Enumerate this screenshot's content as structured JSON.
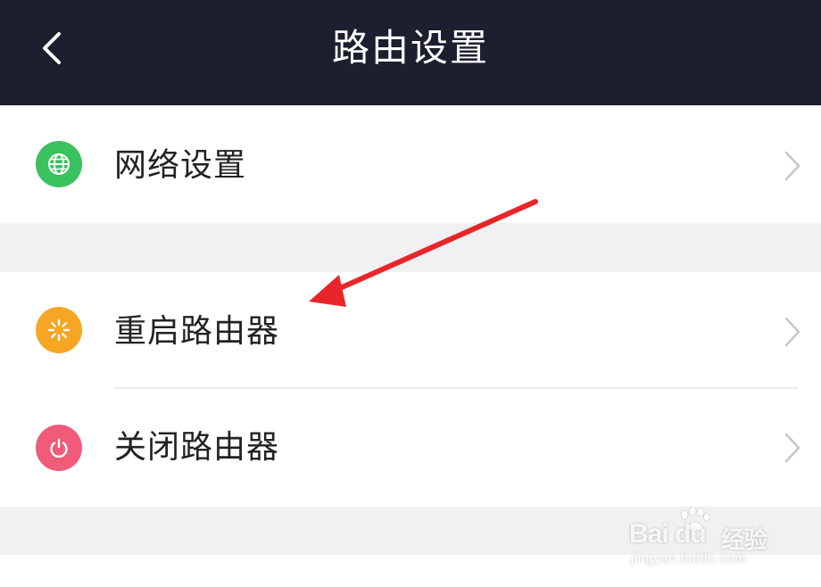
{
  "header": {
    "title": "路由设置",
    "back_icon": "chevron-left-icon"
  },
  "settings": {
    "network": {
      "label": "网络设置",
      "icon": "globe-icon",
      "icon_color": "#3ac25e"
    },
    "restart": {
      "label": "重启路由器",
      "icon": "restart-spinner-icon",
      "icon_color": "#f5a623"
    },
    "shutdown": {
      "label": "关闭路由器",
      "icon": "power-icon",
      "icon_color": "#ef5b78"
    }
  },
  "annotation": {
    "arrow_color": "#e8262a"
  },
  "watermark": {
    "brand": "Bai du",
    "suffix": "经验",
    "url": "jingyan.baidu.com"
  },
  "colors": {
    "header_bg": "#1b1f2e",
    "page_bg": "#f1f1f3",
    "card_bg": "#ffffff",
    "chevron": "#c4c7cc"
  }
}
